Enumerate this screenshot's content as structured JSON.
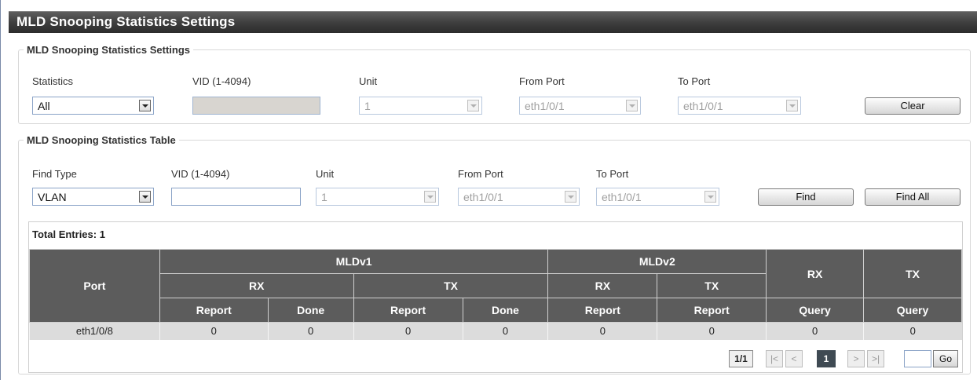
{
  "window": {
    "title": "MLD Snooping Statistics Settings"
  },
  "settings": {
    "legend": "MLD Snooping Statistics Settings",
    "labels": {
      "statistics": "Statistics",
      "vid": "VID (1-4094)",
      "unit": "Unit",
      "from_port": "From Port",
      "to_port": "To Port"
    },
    "values": {
      "statistics": "All",
      "vid": "",
      "unit": "1",
      "from_port": "eth1/0/1",
      "to_port": "eth1/0/1"
    },
    "clear_label": "Clear"
  },
  "table_section": {
    "legend": "MLD Snooping Statistics Table",
    "labels": {
      "find_type": "Find Type",
      "vid": "VID (1-4094)",
      "unit": "Unit",
      "from_port": "From Port",
      "to_port": "To Port"
    },
    "values": {
      "find_type": "VLAN",
      "vid": "",
      "unit": "1",
      "from_port": "eth1/0/1",
      "to_port": "eth1/0/1"
    },
    "find_label": "Find",
    "find_all_label": "Find All"
  },
  "results": {
    "total_entries": "Total Entries: 1",
    "headers": {
      "port": "Port",
      "mldv1": "MLDv1",
      "mldv2": "MLDv2",
      "rx": "RX",
      "tx": "TX",
      "report": "Report",
      "done": "Done",
      "query": "Query"
    },
    "rows": [
      {
        "port": "eth1/0/8",
        "v1_rx_report": "0",
        "v1_rx_done": "0",
        "v1_tx_report": "0",
        "v1_tx_done": "0",
        "v2_rx_report": "0",
        "v2_tx_report": "0",
        "rx_query": "0",
        "tx_query": "0"
      }
    ]
  },
  "pagination": {
    "page_info": "1/1",
    "first": "|<",
    "prev": "<",
    "current": "1",
    "next": ">",
    "last": ">|",
    "go_label": "Go",
    "page_input": ""
  }
}
